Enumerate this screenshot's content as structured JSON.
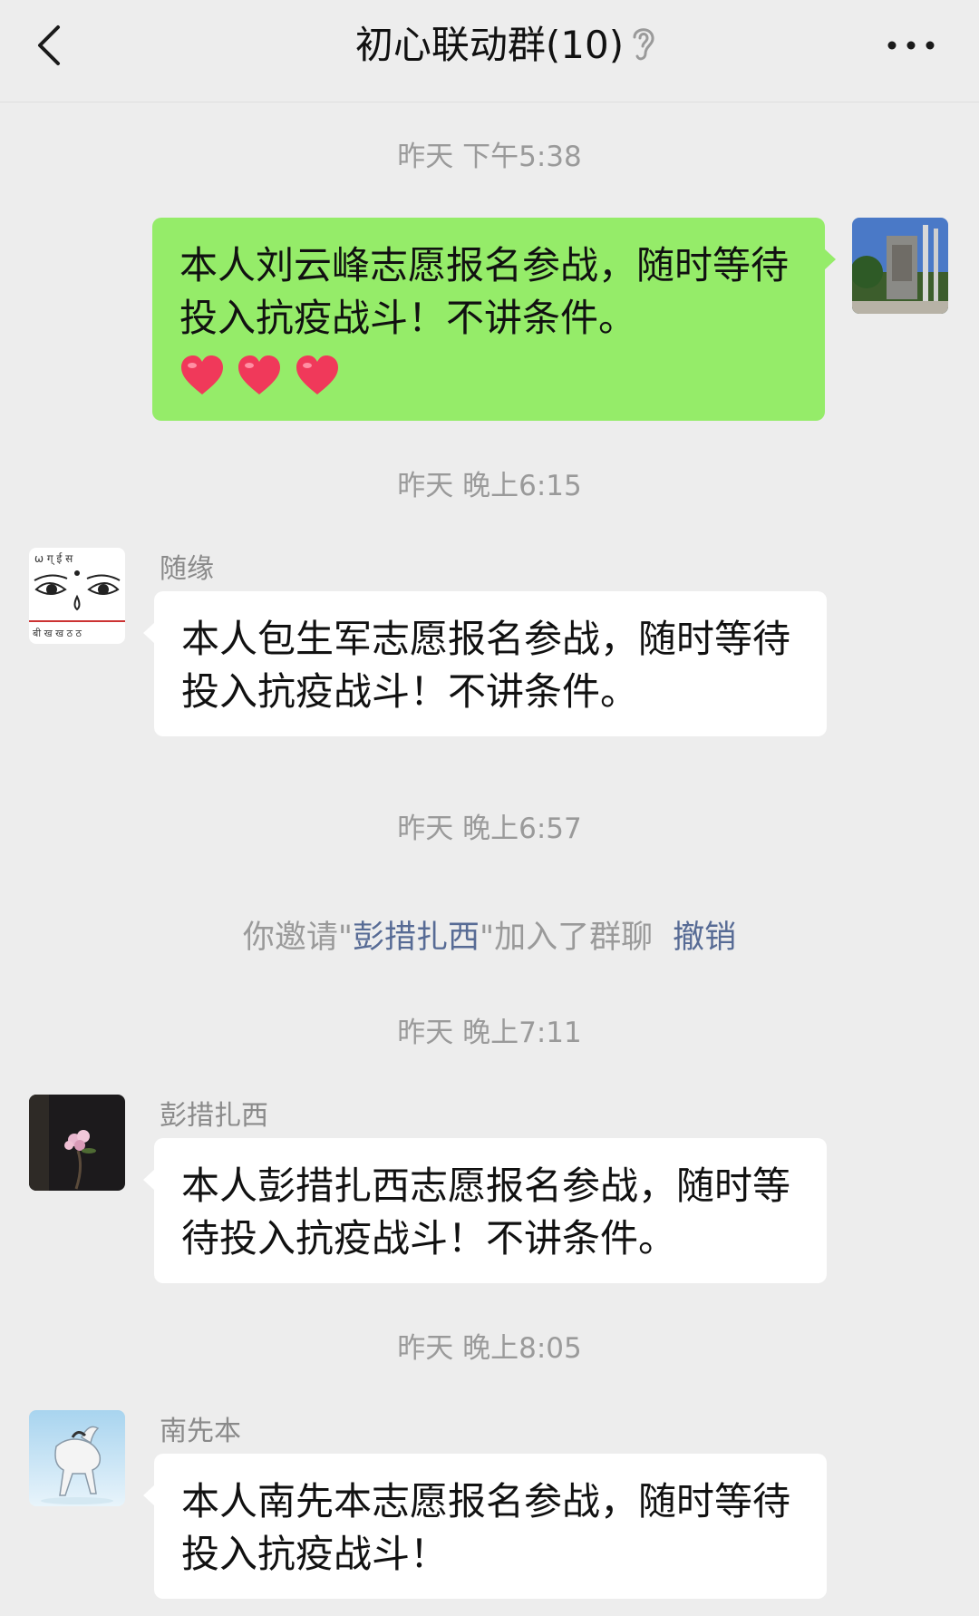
{
  "header": {
    "title": "初心联动群(10)"
  },
  "messages": {
    "t1": "昨天 下午5:38",
    "m1": {
      "text": "本人刘云峰志愿报名参战，随时等待投入抗疫战斗！不讲条件。"
    },
    "t2": "昨天 晚上6:15",
    "m2": {
      "sender": "随缘",
      "text": "本人包生军志愿报名参战，随时等待投入抗疫战斗！不讲条件。"
    },
    "t3": "昨天 晚上6:57",
    "system": {
      "prefix": "你邀请\"",
      "name": "彭措扎西",
      "suffix": "\"加入了群聊",
      "undo": "撤销"
    },
    "t4": "昨天 晚上7:11",
    "m3": {
      "sender": "彭措扎西",
      "text": "本人彭措扎西志愿报名参战，随时等待投入抗疫战斗！不讲条件。"
    },
    "t5": "昨天 晚上8:05",
    "m4": {
      "sender": "南先本",
      "text": "本人南先本志愿报名参战，随时等待投入抗疫战斗！"
    }
  },
  "colors": {
    "background": "#ededed",
    "own_bubble": "#95ec69",
    "other_bubble": "#ffffff",
    "link": "#576b95",
    "meta_text": "#9a9a9a"
  },
  "icons": [
    "chevron-left-icon",
    "ear-icon",
    "more-icon",
    "heart-icon"
  ]
}
